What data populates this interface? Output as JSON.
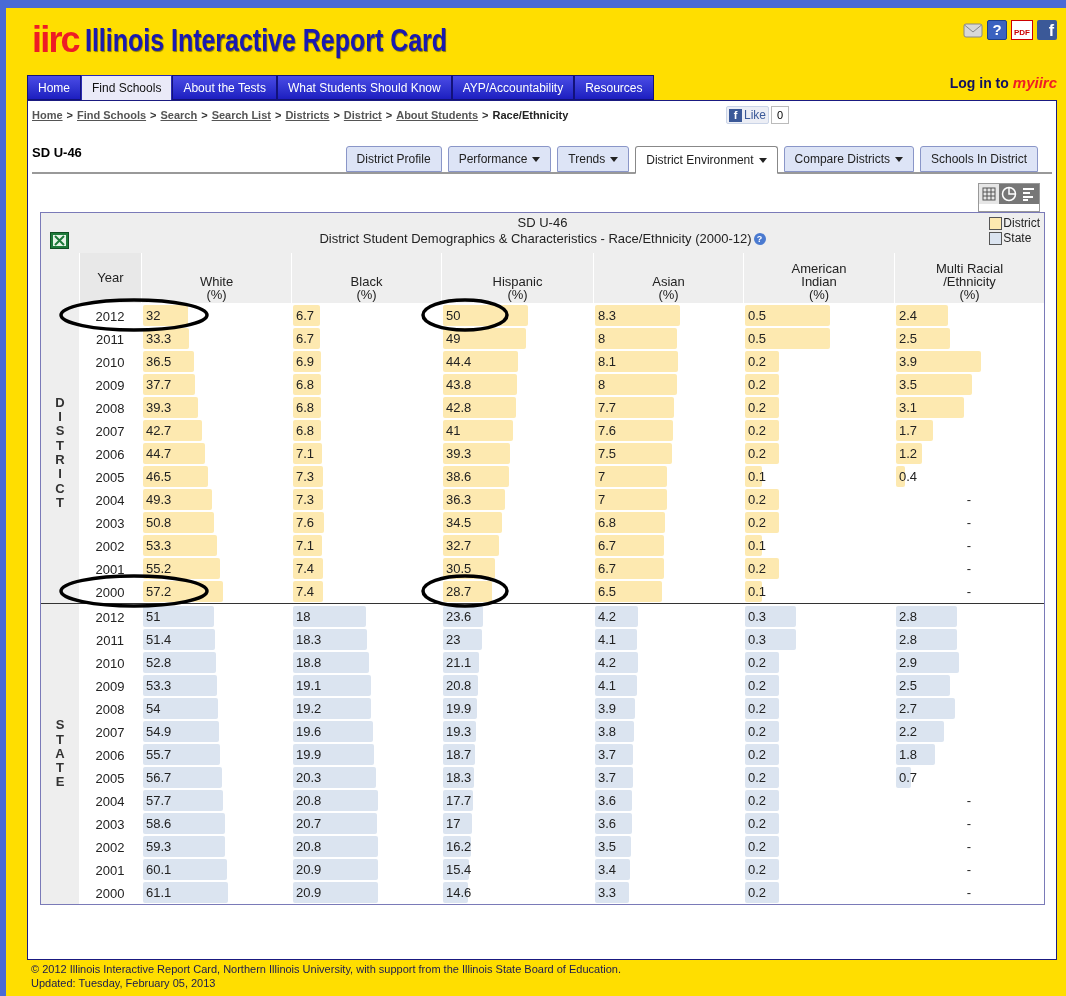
{
  "header": {
    "logo": "iirc",
    "title": "Illinois Interactive Report Card"
  },
  "top_icons": [
    {
      "kind": "mail"
    },
    {
      "kind": "help",
      "glyph": "?"
    },
    {
      "kind": "pdf",
      "glyph": "PDF"
    },
    {
      "kind": "facebook",
      "glyph": "f"
    }
  ],
  "nav_tabs": [
    {
      "label": "Home",
      "selected": false
    },
    {
      "label": "Find Schools",
      "selected": true
    },
    {
      "label": "About the Tests",
      "selected": false
    },
    {
      "label": "What Students Should Know",
      "selected": false
    },
    {
      "label": "AYP/Accountability",
      "selected": false
    },
    {
      "label": "Resources",
      "selected": false
    }
  ],
  "login": {
    "label": "Log in to",
    "brand": "myiirc"
  },
  "breadcrumb": {
    "separator": ">",
    "items": [
      {
        "label": "Home",
        "link": true
      },
      {
        "label": "Find Schools",
        "link": true
      },
      {
        "label": "Search",
        "link": true
      },
      {
        "label": "Search List",
        "link": true
      },
      {
        "label": "Districts",
        "link": true
      },
      {
        "label": "District",
        "link": true
      },
      {
        "label": "About Students",
        "link": true
      },
      {
        "label": "Race/Ethnicity",
        "link": false
      }
    ]
  },
  "like": {
    "glyph": "f",
    "label": "Like",
    "count": "0"
  },
  "district_name": "SD U-46",
  "sub_tabs": [
    {
      "label": "District Profile",
      "dropdown": false,
      "selected": false
    },
    {
      "label": "Performance",
      "dropdown": true,
      "selected": false
    },
    {
      "label": "Trends",
      "dropdown": true,
      "selected": false
    },
    {
      "label": "District Environment",
      "dropdown": true,
      "selected": true
    },
    {
      "label": "Compare Districts",
      "dropdown": true,
      "selected": false
    },
    {
      "label": "Schools In District",
      "dropdown": false,
      "selected": false
    }
  ],
  "view_modes": [
    {
      "kind": "table",
      "selected": true
    },
    {
      "kind": "pie",
      "selected": false
    },
    {
      "kind": "bars",
      "selected": false
    }
  ],
  "table": {
    "title": "SD U-46",
    "subtitle": "District Student Demographics & Characteristics - Race/Ethnicity (2000-12)",
    "help_glyph": "?",
    "legend": [
      {
        "label": "District",
        "color": "#fde9b0"
      },
      {
        "label": "State",
        "color": "#dbe4f0"
      }
    ],
    "year_header": "Year",
    "columns": [
      {
        "label": "White\n(%)"
      },
      {
        "label": "Black\n(%)"
      },
      {
        "label": "Hispanic\n(%)"
      },
      {
        "label": "Asian\n(%)"
      },
      {
        "label": "American\nIndian\n(%)"
      },
      {
        "label": "Multi Racial\n/Ethnicity\n(%)"
      }
    ],
    "sections": [
      {
        "label": "DISTRICT",
        "color": "#fde9b0",
        "rows": [
          {
            "year": "2012",
            "values": [
              "32",
              "6.7",
              "50",
              "8.3",
              "0.5",
              "2.4"
            ],
            "year_circled": true,
            "circled": [
              true,
              false,
              true,
              false,
              false,
              false
            ]
          },
          {
            "year": "2011",
            "values": [
              "33.3",
              "6.7",
              "49",
              "8",
              "0.5",
              "2.5"
            ]
          },
          {
            "year": "2010",
            "values": [
              "36.5",
              "6.9",
              "44.4",
              "8.1",
              "0.2",
              "3.9"
            ]
          },
          {
            "year": "2009",
            "values": [
              "37.7",
              "6.8",
              "43.8",
              "8",
              "0.2",
              "3.5"
            ]
          },
          {
            "year": "2008",
            "values": [
              "39.3",
              "6.8",
              "42.8",
              "7.7",
              "0.2",
              "3.1"
            ]
          },
          {
            "year": "2007",
            "values": [
              "42.7",
              "6.8",
              "41",
              "7.6",
              "0.2",
              "1.7"
            ]
          },
          {
            "year": "2006",
            "values": [
              "44.7",
              "7.1",
              "39.3",
              "7.5",
              "0.2",
              "1.2"
            ]
          },
          {
            "year": "2005",
            "values": [
              "46.5",
              "7.3",
              "38.6",
              "7",
              "0.1",
              "0.4"
            ]
          },
          {
            "year": "2004",
            "values": [
              "49.3",
              "7.3",
              "36.3",
              "7",
              "0.2",
              "-"
            ]
          },
          {
            "year": "2003",
            "values": [
              "50.8",
              "7.6",
              "34.5",
              "6.8",
              "0.2",
              "-"
            ]
          },
          {
            "year": "2002",
            "values": [
              "53.3",
              "7.1",
              "32.7",
              "6.7",
              "0.1",
              "-"
            ]
          },
          {
            "year": "2001",
            "values": [
              "55.2",
              "7.4",
              "30.5",
              "6.7",
              "0.2",
              "-"
            ]
          },
          {
            "year": "2000",
            "values": [
              "57.2",
              "7.4",
              "28.7",
              "6.5",
              "0.1",
              "-"
            ],
            "year_circled": true,
            "circled": [
              true,
              false,
              true,
              false,
              false,
              false
            ]
          }
        ]
      },
      {
        "label": "STATE",
        "color": "#dbe4f0",
        "rows": [
          {
            "year": "2012",
            "values": [
              "51",
              "18",
              "23.6",
              "4.2",
              "0.3",
              "2.8"
            ]
          },
          {
            "year": "2011",
            "values": [
              "51.4",
              "18.3",
              "23",
              "4.1",
              "0.3",
              "2.8"
            ]
          },
          {
            "year": "2010",
            "values": [
              "52.8",
              "18.8",
              "21.1",
              "4.2",
              "0.2",
              "2.9"
            ]
          },
          {
            "year": "2009",
            "values": [
              "53.3",
              "19.1",
              "20.8",
              "4.1",
              "0.2",
              "2.5"
            ]
          },
          {
            "year": "2008",
            "values": [
              "54",
              "19.2",
              "19.9",
              "3.9",
              "0.2",
              "2.7"
            ]
          },
          {
            "year": "2007",
            "values": [
              "54.9",
              "19.6",
              "19.3",
              "3.8",
              "0.2",
              "2.2"
            ]
          },
          {
            "year": "2006",
            "values": [
              "55.7",
              "19.9",
              "18.7",
              "3.7",
              "0.2",
              "1.8"
            ]
          },
          {
            "year": "2005",
            "values": [
              "56.7",
              "20.3",
              "18.3",
              "3.7",
              "0.2",
              "0.7"
            ]
          },
          {
            "year": "2004",
            "values": [
              "57.7",
              "20.8",
              "17.7",
              "3.6",
              "0.2",
              "-"
            ]
          },
          {
            "year": "2003",
            "values": [
              "58.6",
              "20.7",
              "17",
              "3.6",
              "0.2",
              "-"
            ]
          },
          {
            "year": "2002",
            "values": [
              "59.3",
              "20.8",
              "16.2",
              "3.5",
              "0.2",
              "-"
            ]
          },
          {
            "year": "2001",
            "values": [
              "60.1",
              "20.9",
              "15.4",
              "3.4",
              "0.2",
              "-"
            ]
          },
          {
            "year": "2000",
            "values": [
              "61.1",
              "20.9",
              "14.6",
              "3.3",
              "0.2",
              "-"
            ]
          }
        ]
      }
    ]
  },
  "footer": [
    "© 2012 Illinois Interactive Report Card, Northern Illinois University, with support from the Illinois State Board of Education.",
    "Updated: Tuesday, February 05, 2013"
  ]
}
